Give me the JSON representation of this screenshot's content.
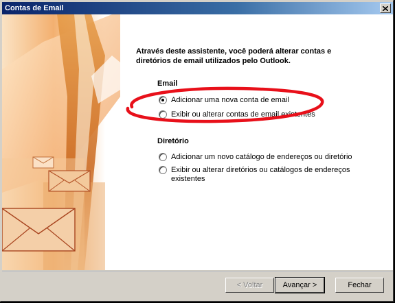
{
  "window": {
    "title": "Contas de Email"
  },
  "intro_text": "Através deste assistente, você poderá alterar contas e diretórios de email utilizados pelo Outlook.",
  "email_group": {
    "label": "Email",
    "options": [
      {
        "label": "Adicionar uma nova conta de email",
        "checked": true
      },
      {
        "label": "Exibir ou alterar contas de email existentes",
        "checked": false
      }
    ]
  },
  "directory_group": {
    "label": "Diretório",
    "options": [
      {
        "label": "Adicionar um novo catálogo de endereços ou diretório",
        "checked": false
      },
      {
        "label": "Exibir ou alterar diretórios ou catálogos de endereços existentes",
        "checked": false
      }
    ]
  },
  "buttons": {
    "back": "< Voltar",
    "next": "Avançar >",
    "close": "Fechar"
  },
  "colors": {
    "annotation": "#e8101a",
    "titlebar": "#0a246a"
  }
}
